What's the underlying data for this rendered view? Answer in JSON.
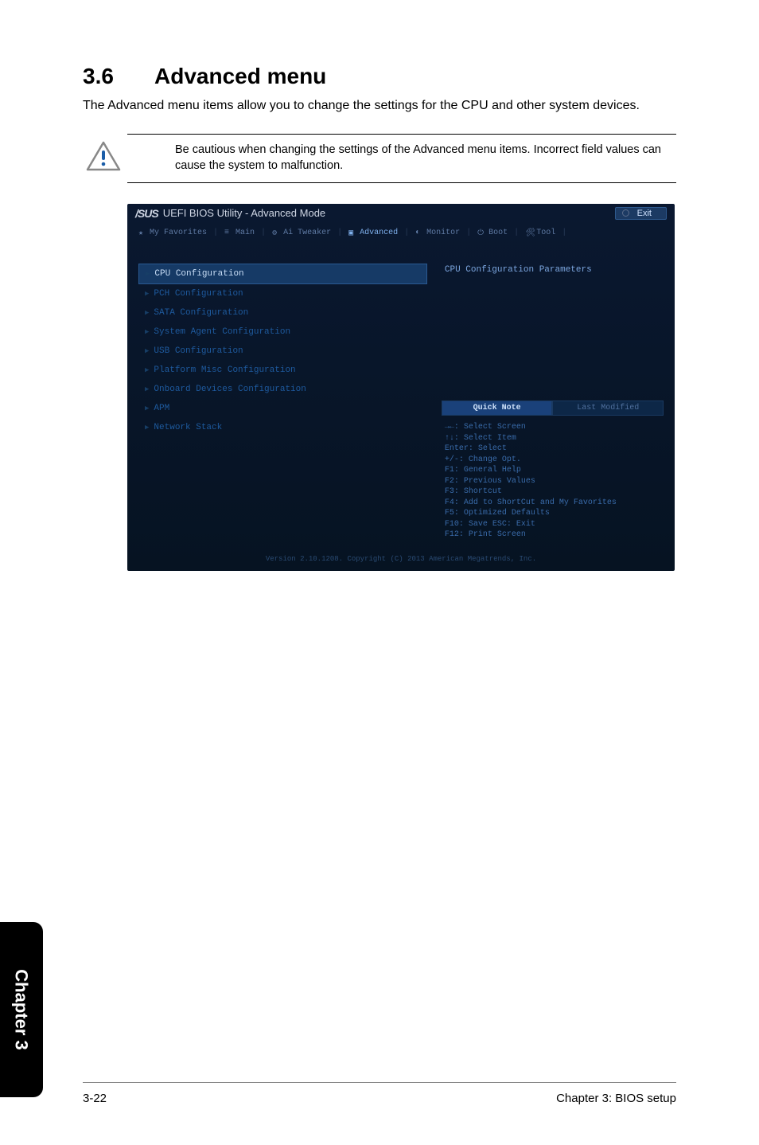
{
  "doc": {
    "section_number": "3.6",
    "section_title": "Advanced menu",
    "intro_text": "The Advanced menu items allow you to change the settings for the CPU and other system devices.",
    "warning_text": "Be cautious when changing the settings of the Advanced menu items. Incorrect field values can cause the system to malfunction."
  },
  "bios": {
    "logo": "/SUS",
    "title": "UEFI BIOS Utility - Advanced Mode",
    "exit_label": "Exit",
    "tabs": [
      {
        "label": "My Favorites",
        "active": false
      },
      {
        "label": "Main",
        "active": false
      },
      {
        "label": "Ai Tweaker",
        "active": false
      },
      {
        "label": "Advanced",
        "active": true
      },
      {
        "label": "Monitor",
        "active": false
      },
      {
        "label": "Boot",
        "active": false
      },
      {
        "label": "Tool",
        "active": false
      }
    ],
    "menu": [
      {
        "label": "CPU Configuration",
        "selected": true
      },
      {
        "label": "PCH Configuration",
        "selected": false
      },
      {
        "label": "SATA Configuration",
        "selected": false
      },
      {
        "label": "System Agent Configuration",
        "selected": false
      },
      {
        "label": "USB Configuration",
        "selected": false
      },
      {
        "label": "Platform Misc Configuration",
        "selected": false
      },
      {
        "label": "Onboard Devices Configuration",
        "selected": false
      },
      {
        "label": "APM",
        "selected": false
      },
      {
        "label": "Network Stack",
        "selected": false
      }
    ],
    "help_title": "CPU Configuration Parameters",
    "help_tabs": {
      "quick_note": "Quick Note",
      "last_modified": "Last Modified"
    },
    "keyhelp": [
      "→←: Select Screen",
      "↑↓: Select Item",
      "Enter: Select",
      "+/-: Change Opt.",
      "F1: General Help",
      "F2: Previous Values",
      "F3: Shortcut",
      "F4: Add to ShortCut and My Favorites",
      "F5: Optimized Defaults",
      "F10: Save  ESC: Exit",
      "F12: Print Screen"
    ],
    "footer": "Version 2.10.1208. Copyright (C) 2013 American Megatrends, Inc."
  },
  "page_footer": {
    "left": "3-22",
    "right": "Chapter 3: BIOS setup",
    "side_tab": "Chapter 3"
  }
}
